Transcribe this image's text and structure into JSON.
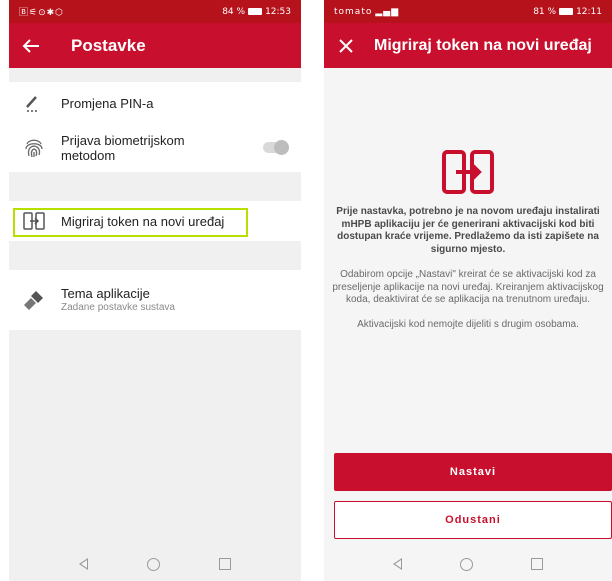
{
  "left_screen": {
    "status": {
      "left_icons": "🄱⚟⊙✱⬡",
      "battery_text": "84 %",
      "time": "12:53"
    },
    "appbar": {
      "back_icon": "back-arrow-icon",
      "title": "Postavke"
    },
    "items": [
      {
        "icon": "pen-icon",
        "label": "Promjena PIN-a"
      },
      {
        "icon": "fingerprint-icon",
        "label": "Prijava biometrijskom metodom",
        "toggle": "off"
      },
      {
        "icon": "migrate-device-icon",
        "label": "Migriraj token na novi uređaj",
        "highlighted": true
      },
      {
        "icon": "brush-icon",
        "label": "Tema aplikacije",
        "sublabel": "Zadane postavke sustava"
      }
    ]
  },
  "right_screen": {
    "status": {
      "carrier": "tomato",
      "battery_text": "81 %",
      "time": "12:11"
    },
    "appbar": {
      "close_icon": "close-icon",
      "title": "Migriraj token na novi uređaj"
    },
    "body": {
      "icon": "migrate-device-icon",
      "bold_text": "Prije nastavka, potrebno je na novom uređaju instalirati mHPB aplikaciju jer će generirani aktivacijski kod biti dostupan kraće vrijeme. Predlažemo da isti zapišete na sigurno mjesto.",
      "text1": "Odabirom opcije „Nastavi\" kreirat će se aktivacijski kod za preseljenje aplikacije na novi uređaj. Kreiranjem aktivacijskog koda, deaktivirat će se aplikacija na trenutnom uređaju.",
      "text2": "Aktivacijski kod nemojte dijeliti s drugim osobama."
    },
    "buttons": {
      "continue": "Nastavi",
      "cancel": "Odustani"
    }
  },
  "colors": {
    "brand_red": "#c8102e",
    "highlight": "#b7e000"
  }
}
